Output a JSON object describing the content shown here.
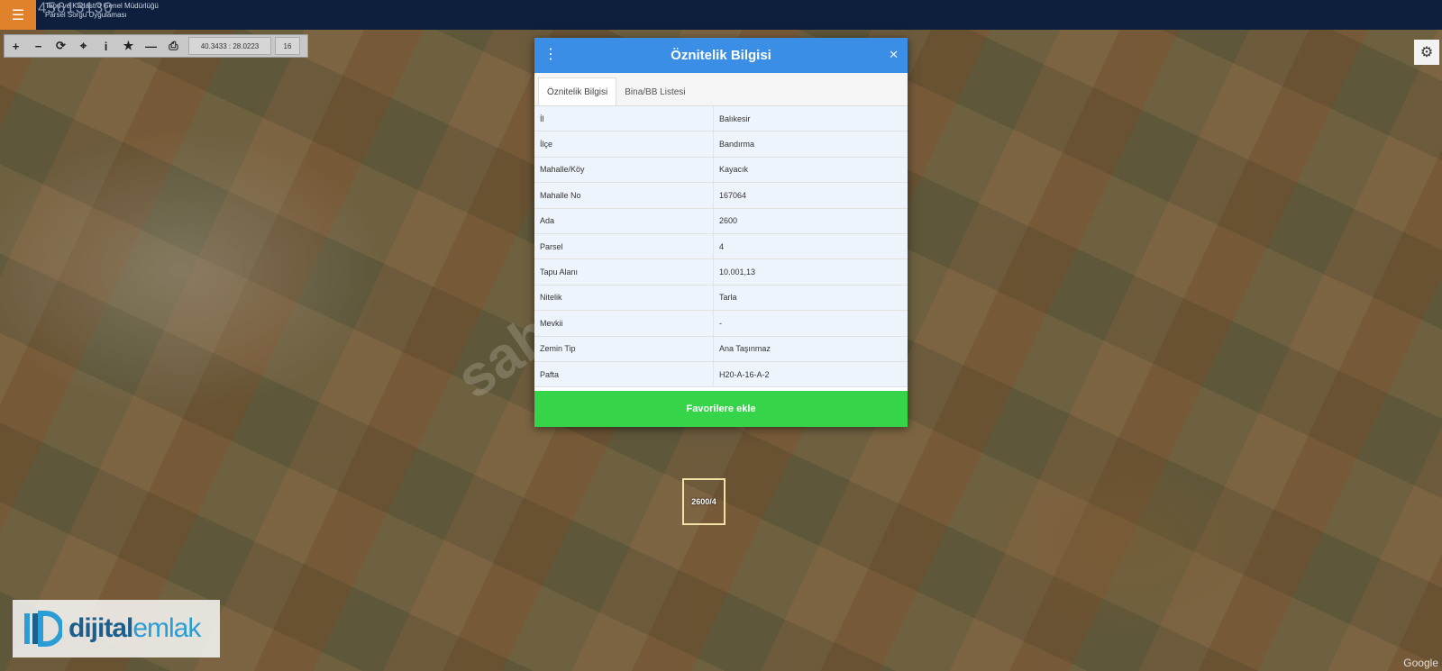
{
  "app": {
    "title_line1": "Tapu ve Kadastro Genel Müdürlüğü",
    "title_line2": "Parsel Sorgu Uygulaması",
    "overlay_number": "45613130"
  },
  "toolbar": {
    "coordinates": "40.3433 : 28.0223",
    "zoom": "16"
  },
  "map": {
    "parcel_label": "2600/4",
    "watermark": "sahibinden.com",
    "provider": "Google"
  },
  "dialog": {
    "title": "Öznitelik Bilgisi",
    "tabs": [
      "Öznitelik Bilgisi",
      "Bina/BB Listesi"
    ],
    "rows": [
      {
        "key": "İl",
        "value": "Balıkesir"
      },
      {
        "key": "İlçe",
        "value": "Bandırma"
      },
      {
        "key": "Mahalle/Köy",
        "value": "Kayacık"
      },
      {
        "key": "Mahalle No",
        "value": "167064"
      },
      {
        "key": "Ada",
        "value": "2600"
      },
      {
        "key": "Parsel",
        "value": "4"
      },
      {
        "key": "Tapu Alanı",
        "value": "10.001,13"
      },
      {
        "key": "Nitelik",
        "value": "Tarla"
      },
      {
        "key": "Mevkii",
        "value": "-"
      },
      {
        "key": "Zemin Tip",
        "value": "Ana Taşınmaz"
      },
      {
        "key": "Pafta",
        "value": "H20-A-16-A-2"
      }
    ],
    "favorite_button": "Favorilere ekle"
  },
  "logo": {
    "brand_part1": "dijital",
    "brand_part2": "emlak"
  },
  "colors": {
    "topbar": "#0d1f3d",
    "menu_button": "#e0812c",
    "dialog_header": "#3a8ee6",
    "favorite_button": "#35d449"
  }
}
